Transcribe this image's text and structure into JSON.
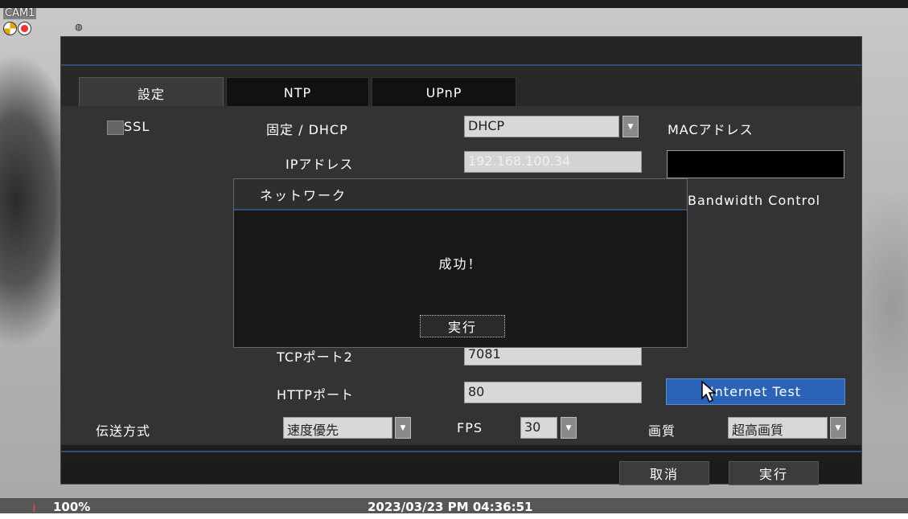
{
  "camera": {
    "label": "CAM1"
  },
  "status": {
    "zoom": "100%",
    "datetime": "2023/03/23 PM 04:36:51"
  },
  "tabs": [
    {
      "label": "設定",
      "active": true
    },
    {
      "label": "NTP",
      "active": false
    },
    {
      "label": "UPnP",
      "active": false
    }
  ],
  "form": {
    "ssl_label": "SSL",
    "ssl_checked": false,
    "ip_mode_label": "固定 / DHCP",
    "ip_mode_value": "DHCP",
    "mac_label": "MACアドレス",
    "ip_label": "IPアドレス",
    "ip_value": "192.168.100.34",
    "bandwidth_label": "Bandwidth Control",
    "tcp2_label": "TCPポート2",
    "tcp2_value": "7081",
    "http_label": "HTTPポート",
    "http_value": "80",
    "internet_test_label": "Internet Test",
    "transfer_label": "伝送方式",
    "transfer_value": "速度優先",
    "fps_label": "FPS",
    "fps_value": "30",
    "quality_label": "画質",
    "quality_value": "超高画質"
  },
  "footer": {
    "cancel_label": "取消",
    "ok_label": "実行"
  },
  "dialog": {
    "title": "ネットワーク",
    "message": "成功！",
    "button_label": "実行"
  },
  "colors": {
    "accent": "#2f4f78",
    "button_blue": "#2b63b8"
  }
}
